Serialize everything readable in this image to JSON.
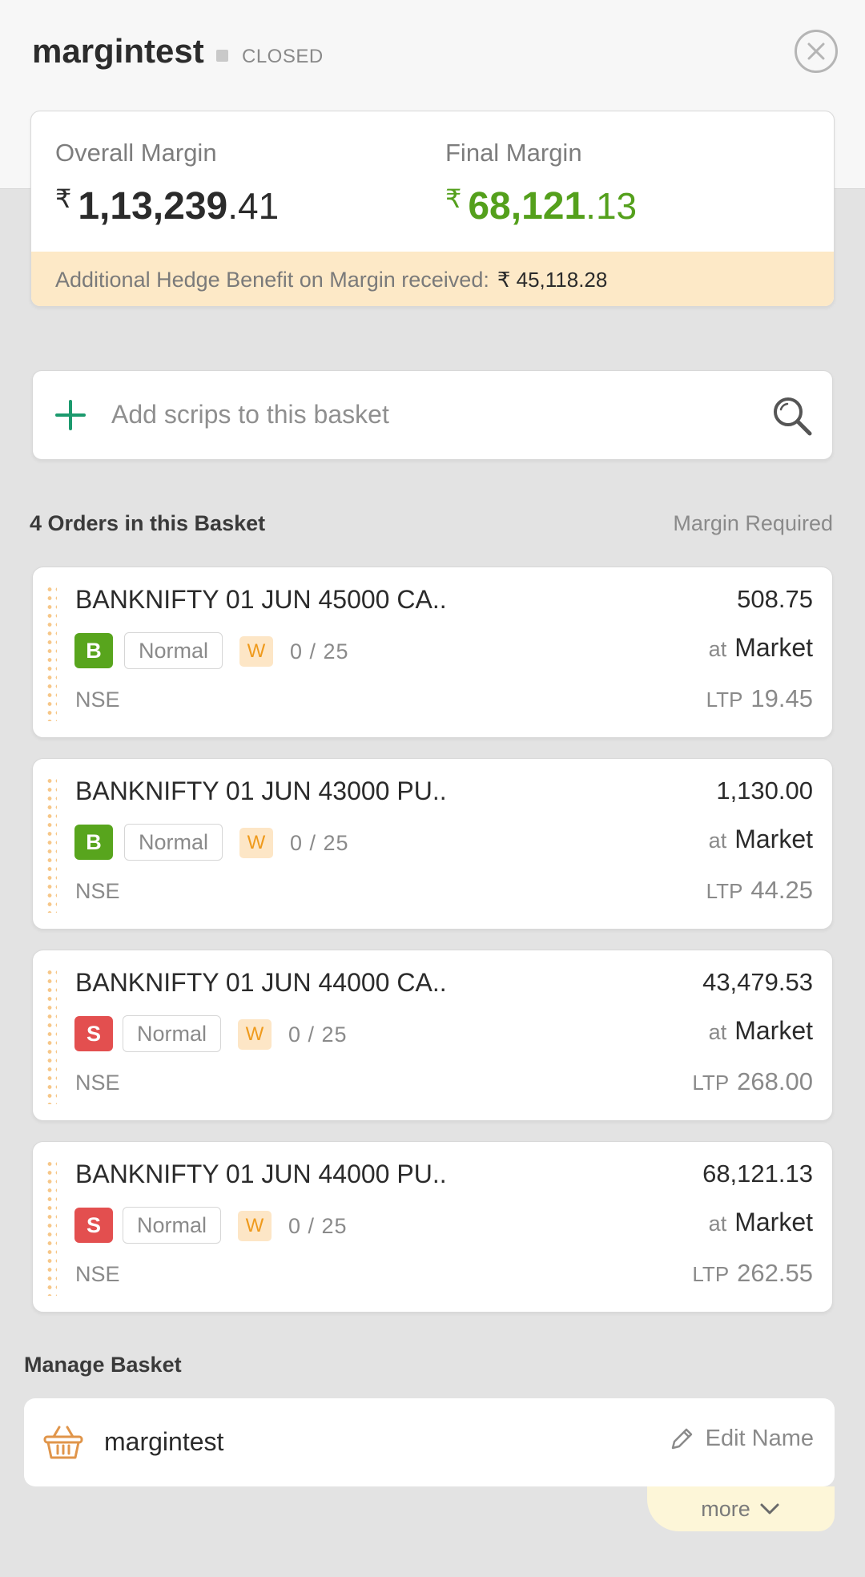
{
  "header": {
    "title": "margintest",
    "status": "CLOSED"
  },
  "margin": {
    "overall_label": "Overall Margin",
    "overall_currency": "₹",
    "overall_int": "1,13,239",
    "overall_dec": ".41",
    "final_label": "Final Margin",
    "final_currency": "₹",
    "final_int": "68,121",
    "final_dec": ".13",
    "final_color": "#54a01c",
    "hedge_label": "Additional Hedge Benefit on Margin received:",
    "hedge_value": "₹ 45,118.28"
  },
  "search": {
    "placeholder": "Add scrips to this basket"
  },
  "orders_section": {
    "heading": "4 Orders in this Basket",
    "margin_required_label": "Margin Required"
  },
  "orders": [
    {
      "name": "BANKNIFTY 01 JUN 45000 CA..",
      "margin": "508.75",
      "side": "B",
      "type": "Normal",
      "validity": "W",
      "qty": "0 / 25",
      "at_label": "at",
      "price_type": "Market",
      "exchange": "NSE",
      "ltp_label": "LTP",
      "ltp": "19.45"
    },
    {
      "name": "BANKNIFTY 01 JUN 43000 PU..",
      "margin": "1,130.00",
      "side": "B",
      "type": "Normal",
      "validity": "W",
      "qty": "0 / 25",
      "at_label": "at",
      "price_type": "Market",
      "exchange": "NSE",
      "ltp_label": "LTP",
      "ltp": "44.25"
    },
    {
      "name": "BANKNIFTY 01 JUN 44000 CA..",
      "margin": "43,479.53",
      "side": "S",
      "type": "Normal",
      "validity": "W",
      "qty": "0 / 25",
      "at_label": "at",
      "price_type": "Market",
      "exchange": "NSE",
      "ltp_label": "LTP",
      "ltp": "268.00"
    },
    {
      "name": "BANKNIFTY 01 JUN 44000 PU..",
      "margin": "68,121.13",
      "side": "S",
      "type": "Normal",
      "validity": "W",
      "qty": "0 / 25",
      "at_label": "at",
      "price_type": "Market",
      "exchange": "NSE",
      "ltp_label": "LTP",
      "ltp": "262.55"
    }
  ],
  "manage": {
    "heading": "Manage Basket",
    "basket_name": "margintest",
    "edit_label": "Edit Name",
    "more_label": "more"
  },
  "colors": {
    "buy": "#58a51d",
    "sell": "#e34f4f",
    "accent_green": "#1c9a6e",
    "hedge_bg": "#fde9c7"
  }
}
